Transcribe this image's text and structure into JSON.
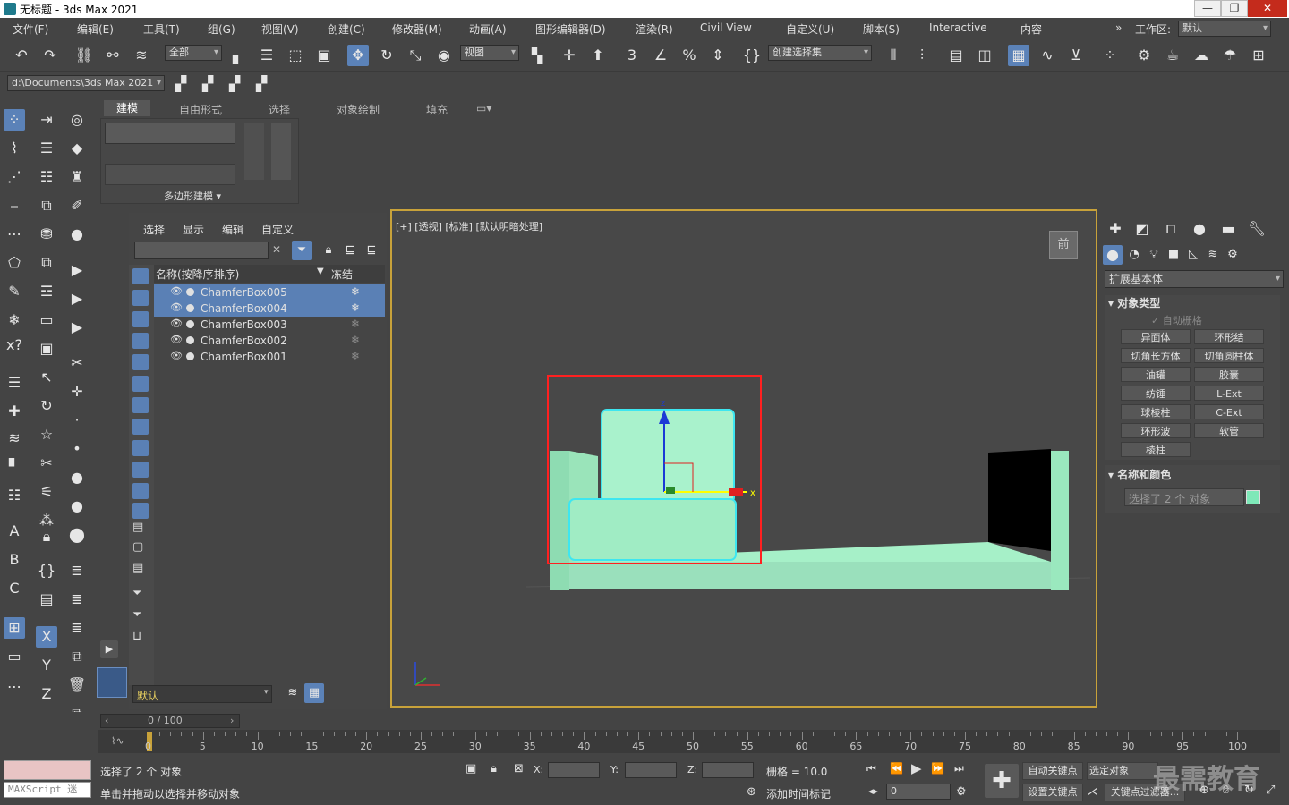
{
  "window": {
    "title": "无标题 - 3ds Max 2021",
    "buttons": [
      "—",
      "❐",
      "✕"
    ]
  },
  "menu": {
    "items": [
      "文件(F)",
      "编辑(E)",
      "工具(T)",
      "组(G)",
      "视图(V)",
      "创建(C)",
      "修改器(M)",
      "动画(A)",
      "图形编辑器(D)",
      "渲染(R)",
      "Civil View",
      "自定义(U)",
      "脚本(S)",
      "Interactive",
      "内容"
    ],
    "workspace_label": "工作区:",
    "workspace_value": "默认"
  },
  "toolbar": {
    "filter_value": "全部",
    "refcoord_value": "视图",
    "selection_set_value": "创建选择集",
    "project_path": "d:\\Documents\\3ds Max 2021"
  },
  "ribbon": {
    "tabs": [
      "建模",
      "自由形式",
      "选择",
      "对象绘制",
      "填充"
    ],
    "group_label": "多边形建模 ▾"
  },
  "scene_explorer": {
    "tabs": [
      "选择",
      "显示",
      "编辑",
      "自定义"
    ],
    "col_name": "名称(按降序排序)",
    "col_freeze": "冻结",
    "rows": [
      {
        "name": "ChamferBox005",
        "selected": true
      },
      {
        "name": "ChamferBox004",
        "selected": true
      },
      {
        "name": "ChamferBox003",
        "selected": false
      },
      {
        "name": "ChamferBox002",
        "selected": false
      },
      {
        "name": "ChamferBox001",
        "selected": false
      }
    ],
    "layer_value": "默认"
  },
  "viewport": {
    "label": "[+] [透视] [标准] [默认明暗处理]",
    "viewcube_label": "前",
    "object_color": "#a6f0c8",
    "axis_x": "x",
    "axis_z": "z"
  },
  "command_panel": {
    "category_value": "扩展基本体",
    "rollout_object_type": "对象类型",
    "autogrid_label": "自动栅格",
    "buttons": [
      "异面体",
      "环形结",
      "切角长方体",
      "切角圆柱体",
      "油罐",
      "胶囊",
      "纺锤",
      "L-Ext",
      "球棱柱",
      "C-Ext",
      "环形波",
      "软管",
      "棱柱"
    ],
    "rollout_name_color": "名称和颜色",
    "name_field_value": "选择了 2 个 对象",
    "swatch_color": "#7ee8b8"
  },
  "timeline": {
    "frame_label": "0 / 100",
    "ticks": [
      "0",
      "5",
      "10",
      "15",
      "20",
      "25",
      "30",
      "35",
      "40",
      "45",
      "50",
      "55",
      "60",
      "65",
      "70",
      "75",
      "80",
      "85",
      "90",
      "95",
      "100"
    ]
  },
  "status": {
    "maxscript_label": "MAXScript 迷",
    "line1": "选择了 2 个 对象",
    "line2": "单击并拖动以选择并移动对象",
    "x_label": "X:",
    "y_label": "Y:",
    "z_label": "Z:",
    "grid_label": "栅格 = 10.0",
    "add_time_tag": "添加时间标记",
    "autokey": "自动关键点",
    "set_key": "设置关键点",
    "selected_obj": "选定对象",
    "key_filters": "关键点过滤器...",
    "current_frame": "0",
    "watermark": "最需教育"
  }
}
